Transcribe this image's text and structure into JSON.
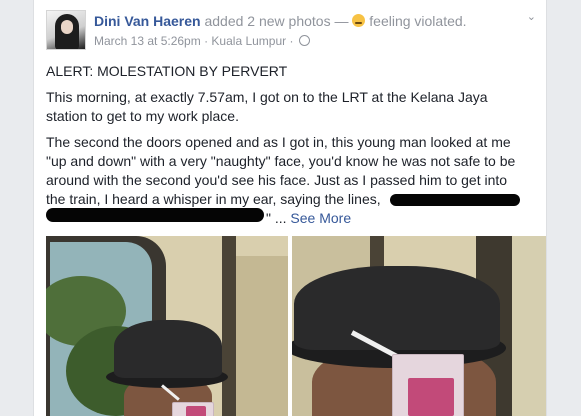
{
  "post": {
    "author_name": "Dini Van Haeren",
    "action_text": "added 2 new photos",
    "separator": "—",
    "feeling_text": "feeling violated.",
    "timestamp": "March 13 at 5:26pm",
    "dot": "·",
    "location": "Kuala Lumpur",
    "menu_glyph": "⌄",
    "paragraph_1": "ALERT: MOLESTATION BY PERVERT",
    "paragraph_2": "This morning, at exactly 7.57am, I got on to the LRT at the Kelana Jaya station to get to my work place.",
    "paragraph_3": "The second the doors opened and as I got in, this young man looked at me \"up and down\" with a very \"naughty\" face, you'd know he was not safe to be around with the second you'd see his face. Just as I passed him to get into the train, I heard a whisper in my ear, saying the lines,",
    "paragraph_3_tail": "\" ...",
    "see_more": "See More"
  },
  "icons": {
    "feeling": "crying-face-icon",
    "privacy": "globe-icon",
    "menu": "chevron-down-icon"
  },
  "colors": {
    "link_blue": "#365899",
    "meta_gray": "#90949c",
    "text_dark": "#1d2129",
    "page_bg": "#e9ebee",
    "redaction": "#050505"
  }
}
